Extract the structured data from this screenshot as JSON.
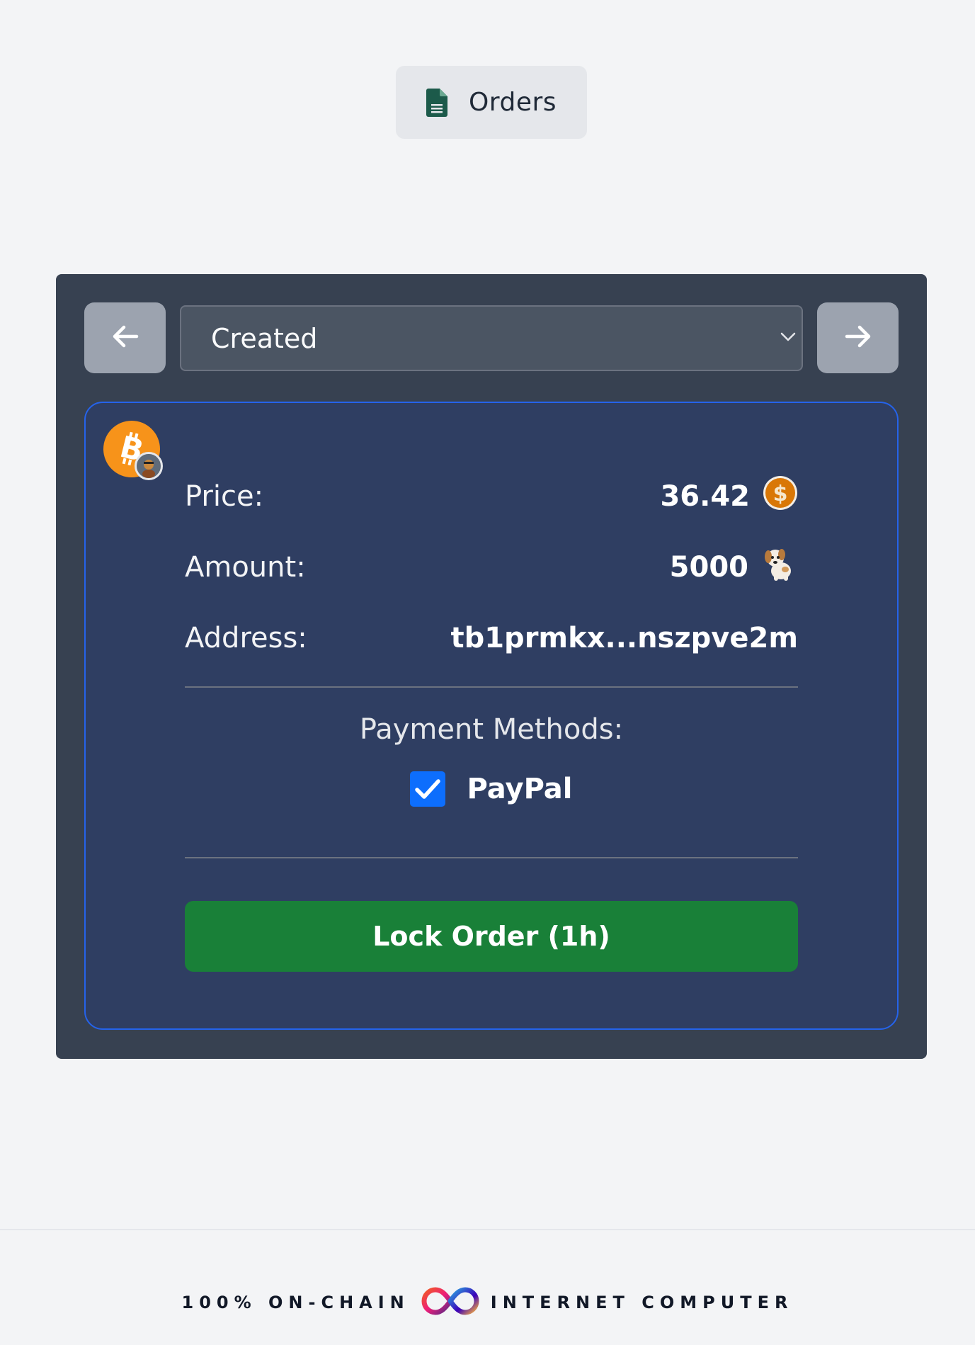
{
  "header": {
    "orders_label": "Orders",
    "orders_icon": "document-icon"
  },
  "filter": {
    "prev_icon": "arrow-left-icon",
    "next_icon": "arrow-right-icon",
    "selected_status": "Created"
  },
  "order": {
    "asset_icon": "bitcoin-icon",
    "price_label": "Price:",
    "price_value": "36.42",
    "price_currency_icon": "dollar-coin-icon",
    "amount_label": "Amount:",
    "amount_value": "5000",
    "amount_token_icon": "dog-emoji-icon",
    "address_label": "Address:",
    "address_value": "tb1prmkx...nszpve2m",
    "payment_methods_title": "Payment Methods:",
    "payment_methods": [
      {
        "label": "PayPal",
        "checked": true
      }
    ],
    "lock_button_label": "Lock Order (1h)"
  },
  "footer": {
    "left_text": "100% ON-CHAIN",
    "right_text": "INTERNET COMPUTER",
    "logo_icon": "internet-computer-infinity-icon"
  },
  "colors": {
    "page_bg": "#f3f4f6",
    "panel_bg": "#374151",
    "card_bg": "#2f3e62",
    "card_border": "#2563eb",
    "lock_button": "#198038",
    "bitcoin": "#f7931a",
    "checkbox": "#0d6efd"
  }
}
